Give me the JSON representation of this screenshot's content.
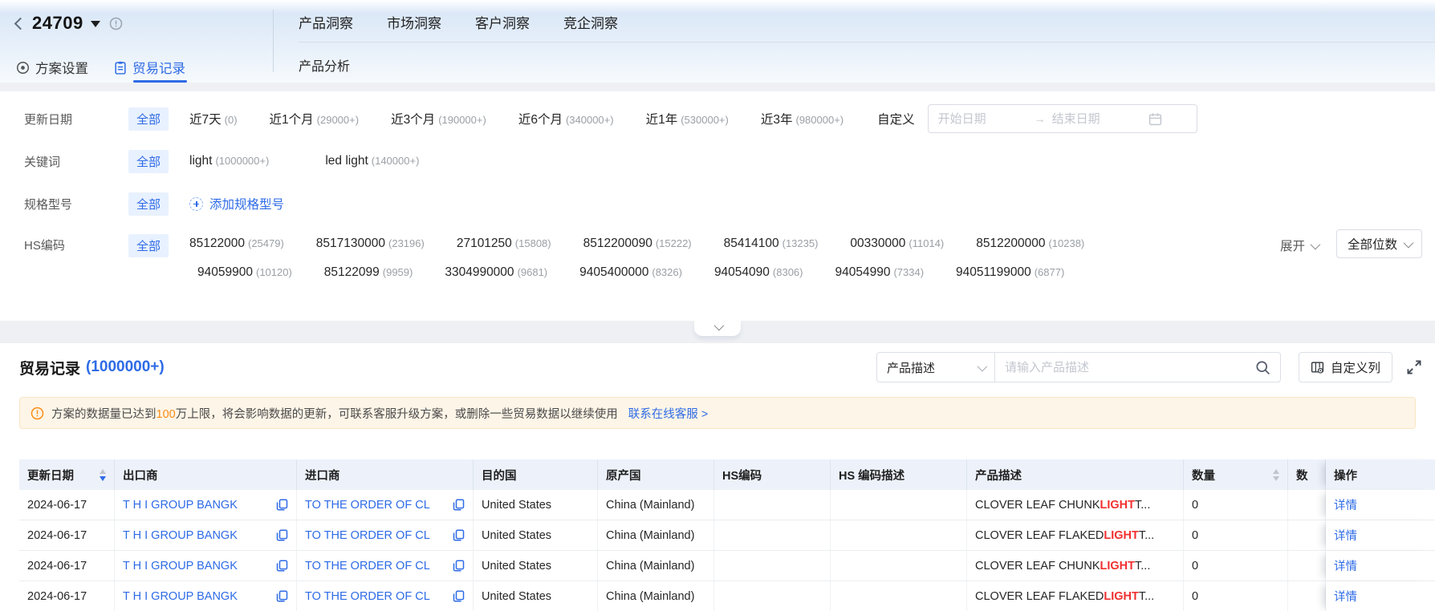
{
  "colors": {
    "accent": "#2e6be6",
    "warning_orange": "#fa8c16",
    "highlight_red": "#f23030",
    "table_header_bg": "#edf2fa"
  },
  "header": {
    "plan_id": "24709",
    "tabs": [
      {
        "label": "产品洞察"
      },
      {
        "label": "市场洞察"
      },
      {
        "label": "客户洞察"
      },
      {
        "label": "竞企洞察"
      }
    ],
    "subtabs": {
      "plan_settings": "方案设置",
      "trade_records": "贸易记录"
    },
    "sub_nav": {
      "product_analysis": "产品分析"
    }
  },
  "filters": {
    "update_date": {
      "label": "更新日期",
      "all": "全部",
      "options": [
        {
          "label": "近7天",
          "count": "(0)"
        },
        {
          "label": "近1个月",
          "count": "(29000+)"
        },
        {
          "label": "近3个月",
          "count": "(190000+)"
        },
        {
          "label": "近6个月",
          "count": "(340000+)"
        },
        {
          "label": "近1年",
          "count": "(530000+)"
        },
        {
          "label": "近3年",
          "count": "(980000+)"
        }
      ],
      "custom_label": "自定义",
      "start_placeholder": "开始日期",
      "end_placeholder": "结束日期",
      "range_separator": "→"
    },
    "keyword": {
      "label": "关键词",
      "all": "全部",
      "options": [
        {
          "label": "light",
          "count": "(1000000+)"
        },
        {
          "label": "led light",
          "count": "(140000+)"
        }
      ]
    },
    "spec": {
      "label": "规格型号",
      "all": "全部",
      "add_label": "添加规格型号"
    },
    "hs_code": {
      "label": "HS编码",
      "all": "全部",
      "row1": [
        {
          "code": "85122000",
          "count": "(25479)"
        },
        {
          "code": "8517130000",
          "count": "(23196)"
        },
        {
          "code": "27101250",
          "count": "(15808)"
        },
        {
          "code": "8512200090",
          "count": "(15222)"
        },
        {
          "code": "85414100",
          "count": "(13235)"
        },
        {
          "code": "00330000",
          "count": "(11014)"
        },
        {
          "code": "8512200000",
          "count": "(10238)"
        }
      ],
      "row2": [
        {
          "code": "94059900",
          "count": "(10120)"
        },
        {
          "code": "85122099",
          "count": "(9959)"
        },
        {
          "code": "3304990000",
          "count": "(9681)"
        },
        {
          "code": "9405400000",
          "count": "(8326)"
        },
        {
          "code": "94054090",
          "count": "(8306)"
        },
        {
          "code": "94054990",
          "count": "(7334)"
        },
        {
          "code": "94051199000",
          "count": "(6877)"
        }
      ],
      "expand_label": "展开",
      "digits_label": "全部位数"
    }
  },
  "records": {
    "title": "贸易记录",
    "count": "(1000000+)",
    "search_select": "产品描述",
    "search_placeholder": "请输入产品描述",
    "custom_columns_label": "自定义列",
    "warning": {
      "pre": "方案的数据量已达到",
      "highlight": "100",
      "post": "万上限，将会影响数据的更新，可联系客服升级方案，或删除一些贸易数据以继续使用",
      "link": "联系在线客服 >"
    },
    "table": {
      "columns": [
        "更新日期",
        "出口商",
        "进口商",
        "目的国",
        "原产国",
        "HS编码",
        "HS 编码描述",
        "产品描述",
        "数量",
        "数",
        "操作"
      ],
      "rows": [
        {
          "date": "2024-06-17",
          "exporter": "T H I GROUP BANGK",
          "importer": "TO THE ORDER OF CL",
          "dest": "United States",
          "origin": "China (Mainland)",
          "hs": "",
          "hs_desc": "",
          "desc_pre": "CLOVER LEAF CHUNK ",
          "desc_hl": "LIGHT",
          "desc_post": " T...",
          "qty": "0",
          "qty2": "",
          "action": "详情"
        },
        {
          "date": "2024-06-17",
          "exporter": "T H I GROUP BANGK",
          "importer": "TO THE ORDER OF CL",
          "dest": "United States",
          "origin": "China (Mainland)",
          "hs": "",
          "hs_desc": "",
          "desc_pre": "CLOVER LEAF FLAKED ",
          "desc_hl": "LIGHT",
          "desc_post": " T...",
          "qty": "0",
          "qty2": "",
          "action": "详情"
        },
        {
          "date": "2024-06-17",
          "exporter": "T H I GROUP BANGK",
          "importer": "TO THE ORDER OF CL",
          "dest": "United States",
          "origin": "China (Mainland)",
          "hs": "",
          "hs_desc": "",
          "desc_pre": "CLOVER LEAF CHUNK ",
          "desc_hl": "LIGHT",
          "desc_post": " T...",
          "qty": "0",
          "qty2": "",
          "action": "详情"
        },
        {
          "date": "2024-06-17",
          "exporter": "T H I GROUP BANGK",
          "importer": "TO THE ORDER OF CL",
          "dest": "United States",
          "origin": "China (Mainland)",
          "hs": "",
          "hs_desc": "",
          "desc_pre": "CLOVER LEAF FLAKED ",
          "desc_hl": "LIGHT",
          "desc_post": " T...",
          "qty": "0",
          "qty2": "",
          "action": "详情"
        }
      ]
    }
  }
}
